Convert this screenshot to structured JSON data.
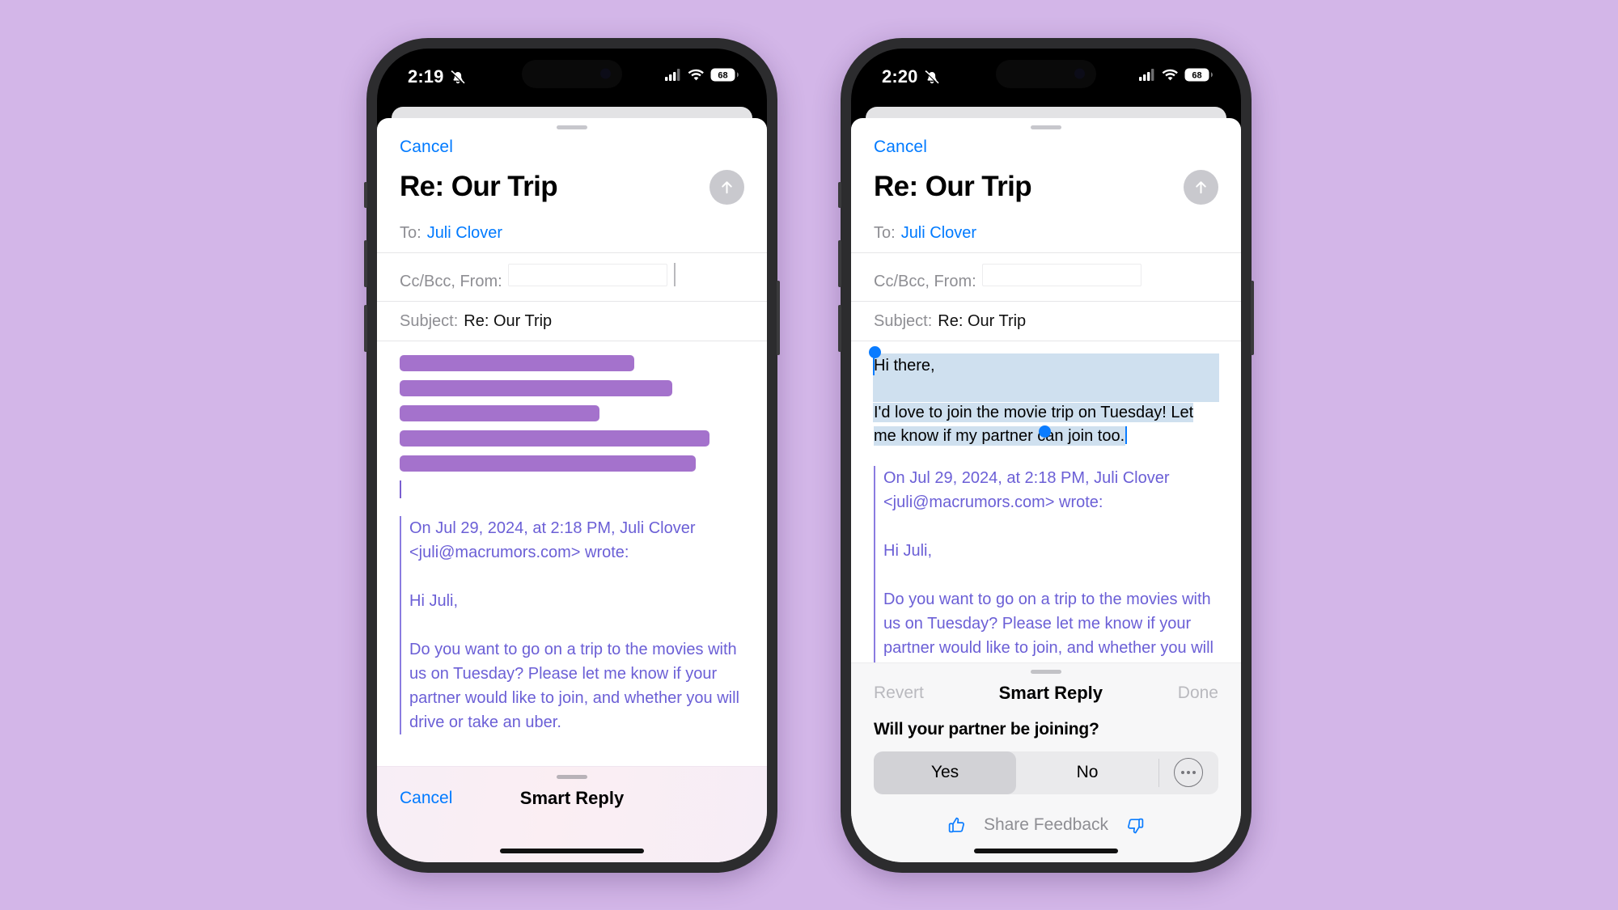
{
  "background_color": "#d3b6e8",
  "accent_color": "#007aff",
  "redaction_color": "#a472cc",
  "quote_color": "#6b5fd6",
  "selection_color": "#cfe0ef",
  "phones": [
    {
      "id": "left",
      "status_bar": {
        "time": "2:19",
        "silent_icon": "bell-slash-icon",
        "cellular_icon": "cellular-bars-icon",
        "wifi_icon": "wifi-icon",
        "battery_level": "68"
      },
      "compose": {
        "cancel_label": "Cancel",
        "title": "Re: Our Trip",
        "send_icon": "arrow-up-icon",
        "to_label": "To:",
        "to_value": "Juli Clover",
        "ccbcc_label": "Cc/Bcc, From:",
        "ccbcc_value": "",
        "subject_label": "Subject:",
        "subject_value": "Re: Our Trip",
        "redaction_bars": [
          {
            "width_pct": 68
          },
          {
            "width_pct": 79
          },
          {
            "width_pct": 58
          },
          {
            "width_pct": 90
          },
          {
            "width_pct": 86
          }
        ],
        "quote": {
          "attribution": "On Jul 29, 2024, at 2:18 PM, Juli Clover <juli@macrumors.com> wrote:",
          "greeting": "Hi Juli,",
          "body": "Do you want to go on a trip to the movies with us on Tuesday? Please let me know if your partner would like to join, and whether you will drive or take an uber."
        }
      },
      "smart_reply_bar": {
        "cancel_label": "Cancel",
        "title": "Smart Reply"
      }
    },
    {
      "id": "right",
      "status_bar": {
        "time": "2:20",
        "silent_icon": "bell-slash-icon",
        "cellular_icon": "cellular-bars-icon",
        "wifi_icon": "wifi-icon",
        "battery_level": "68"
      },
      "compose": {
        "cancel_label": "Cancel",
        "title": "Re: Our Trip",
        "send_icon": "arrow-up-icon",
        "to_label": "To:",
        "to_value": "Juli Clover",
        "ccbcc_label": "Cc/Bcc, From:",
        "ccbcc_value": "",
        "subject_label": "Subject:",
        "subject_value": "Re: Our Trip",
        "reply_greeting": "Hi there,",
        "reply_body": "I'd love to join the movie trip on Tuesday! Let me know if my partner can join too.",
        "quote": {
          "attribution": "On Jul 29, 2024, at 2:18 PM, Juli Clover <juli@macrumors.com> wrote:",
          "greeting": "Hi Juli,",
          "body": "Do you want to go on a trip to the movies with us on Tuesday? Please let me know if your partner would like to join, and whether you will drive or take"
        }
      },
      "smart_reply_panel": {
        "revert_label": "Revert",
        "title": "Smart Reply",
        "done_label": "Done",
        "question": "Will your partner be joining?",
        "options": [
          {
            "label": "Yes",
            "selected": true
          },
          {
            "label": "No",
            "selected": false
          }
        ],
        "more_icon": "ellipsis-circle-icon",
        "feedback": {
          "thumbs_up_icon": "thumbs-up-icon",
          "label": "Share Feedback",
          "thumbs_down_icon": "thumbs-down-icon"
        }
      }
    }
  ]
}
